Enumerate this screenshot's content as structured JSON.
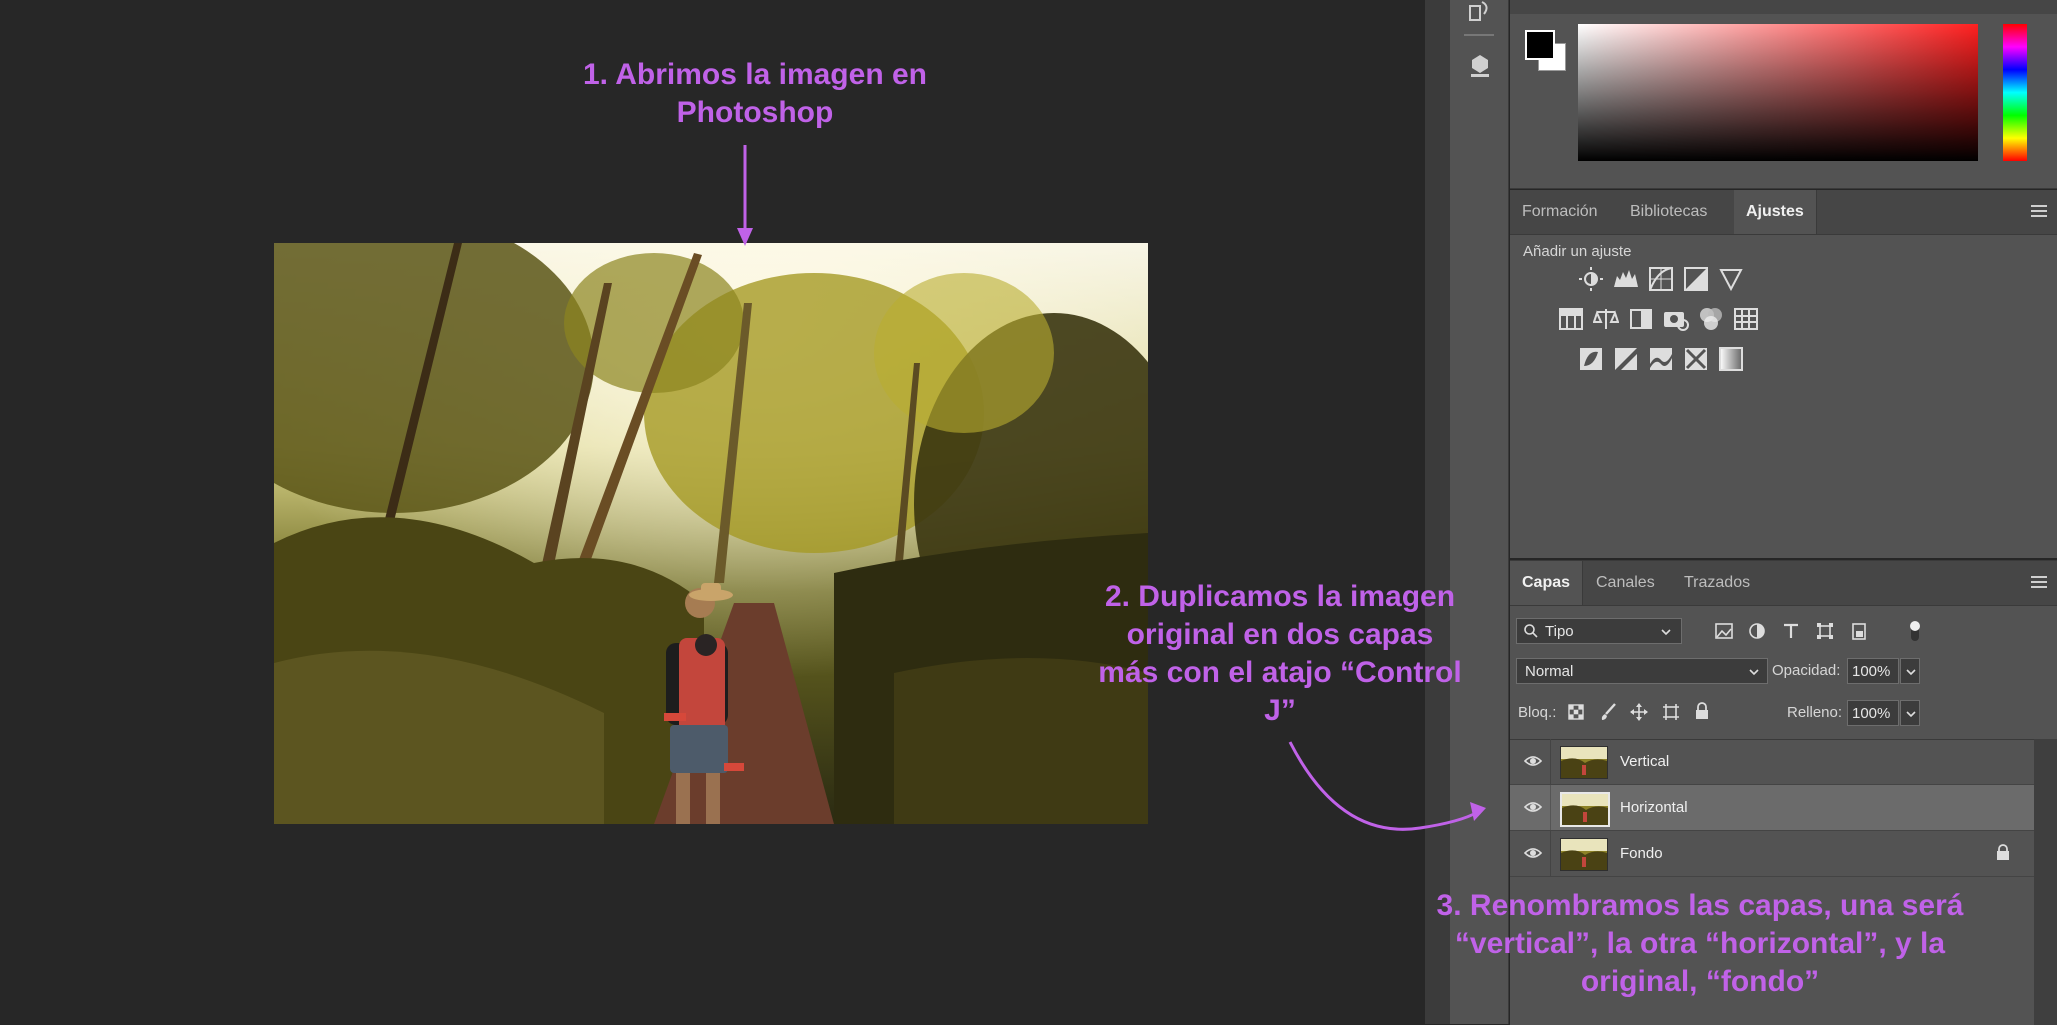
{
  "annotations": {
    "step1_line1": "1. Abrimos la imagen en",
    "step1_line2": "Photoshop",
    "step2_line1": "2. Duplicamos la imagen",
    "step2_line2": "original en dos capas",
    "step2_line3": "más con el atajo “Control",
    "step2_line4": "J”",
    "step3_line1": "3. Renombramos las capas, una será",
    "step3_line2": "“vertical”, la otra “horizontal”, y la",
    "step3_line3": "original, “fondo”"
  },
  "adjust_panel": {
    "tabs": [
      {
        "label": "Formación",
        "active": false
      },
      {
        "label": "Bibliotecas",
        "active": false
      },
      {
        "label": "Ajustes",
        "active": true
      }
    ],
    "heading": "Añadir un ajuste"
  },
  "layers_panel": {
    "tabs": [
      {
        "label": "Capas",
        "active": true
      },
      {
        "label": "Canales",
        "active": false
      },
      {
        "label": "Trazados",
        "active": false
      }
    ],
    "filter_label": "Tipo",
    "blend_mode": "Normal",
    "opacity_label": "Opacidad:",
    "opacity_value": "100%",
    "lock_label": "Bloq.:",
    "fill_label": "Relleno:",
    "fill_value": "100%",
    "layers": [
      {
        "name": "Vertical",
        "selected": false,
        "locked": false
      },
      {
        "name": "Horizontal",
        "selected": true,
        "locked": false
      },
      {
        "name": "Fondo",
        "selected": false,
        "locked": true
      }
    ]
  },
  "colors": {
    "annotation": "#c062e8",
    "panel": "#535353",
    "canvas": "#272727"
  }
}
